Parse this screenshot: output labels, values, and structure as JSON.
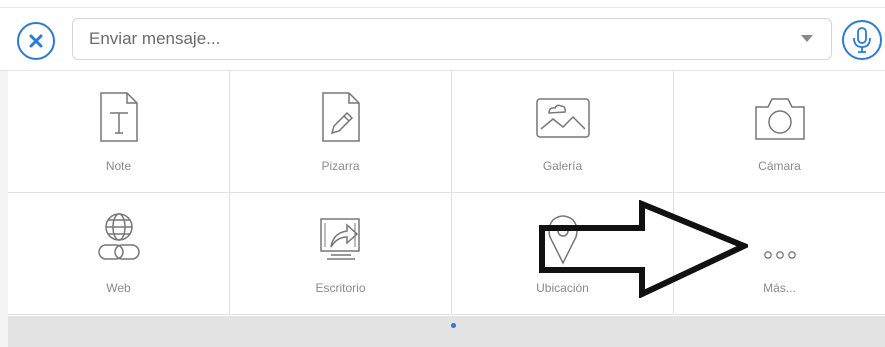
{
  "header": {
    "message_placeholder": "Enviar mensaje..."
  },
  "tiles": [
    {
      "label": "Note",
      "icon": "note-icon"
    },
    {
      "label": "Pizarra",
      "icon": "whiteboard-icon"
    },
    {
      "label": "Galería",
      "icon": "gallery-icon"
    },
    {
      "label": "Cámara",
      "icon": "camera-icon"
    },
    {
      "label": "Web",
      "icon": "web-icon"
    },
    {
      "label": "Escritorio",
      "icon": "desktop-share-icon"
    },
    {
      "label": "Ubicación",
      "icon": "location-icon"
    },
    {
      "label": "Más...",
      "icon": "more-icon"
    }
  ],
  "pager": {
    "current_page": 1,
    "total_pages": 1
  },
  "colors": {
    "accent": "#2a7bd6",
    "label": "#8a8a8a",
    "icon_stroke": "#777777",
    "footer": "#e3e3e3"
  }
}
